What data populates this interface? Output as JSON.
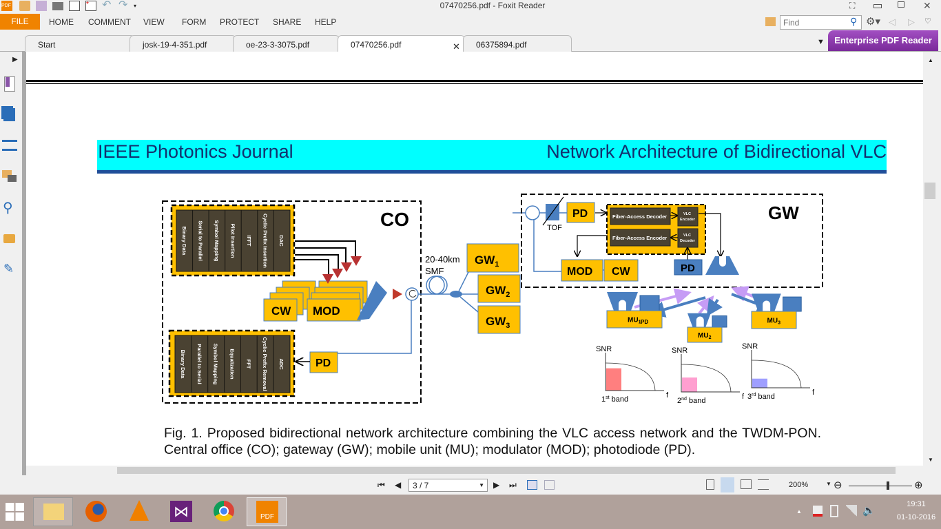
{
  "window": {
    "title": "07470256.pdf - Foxit Reader"
  },
  "menu": {
    "file": "FILE",
    "items": [
      "HOME",
      "COMMENT",
      "VIEW",
      "FORM",
      "PROTECT",
      "SHARE",
      "HELP"
    ]
  },
  "search": {
    "placeholder": "Find"
  },
  "tabs": [
    {
      "label": "Start"
    },
    {
      "label": "josk-19-4-351.pdf"
    },
    {
      "label": "oe-23-3-3075.pdf"
    },
    {
      "label": "07470256.pdf",
      "active": true
    },
    {
      "label": "06375894.pdf"
    }
  ],
  "promo": "Enterprise PDF Reader",
  "sidebar": {
    "icons": [
      "bookmark-icon",
      "pages-icon",
      "layers-icon",
      "comments-icon",
      "attachment-icon",
      "security-icon",
      "signature-icon"
    ]
  },
  "page": {
    "journal": "IEEE Photonics Journal",
    "section": "Network Architecture of Bidirectional VLC",
    "header_color": "#00ffff",
    "figure": {
      "co": "CO",
      "gw": "GW",
      "tx_blocks": [
        "Binary Data",
        "Serial to Parallel",
        "Symbol Mapping",
        "Pilot Insertion",
        "IFFT",
        "Cyclic Prefix Insertion",
        "DAC"
      ],
      "rx_blocks": [
        "Binary Data",
        "Parallel to Serial",
        "Symbol Mapping",
        "Equalization",
        "FFT",
        "Cyclic Prefix Removal",
        "ADC"
      ],
      "cw": "CW",
      "mod": "MOD",
      "pd": "PD",
      "tof": "TOF",
      "fiber1": "20-40km",
      "fiber2": "SMF",
      "gw_label": "GW",
      "gw_subs": [
        "1",
        "2",
        "3"
      ],
      "fa_decoder": "Fiber-Access Decoder",
      "fa_encoder": "Fiber-Access Encoder",
      "vlc_enc": [
        "VLC",
        "Encoder"
      ],
      "vlc_dec": [
        "VLC",
        "Decoder"
      ],
      "mu_label": "MU",
      "mu_subs": [
        "1",
        "2",
        "3"
      ],
      "snr": "SNR",
      "f": "f",
      "bands": [
        {
          "n": "1",
          "sup": "st",
          "label": " band",
          "color": "#ff7f7f"
        },
        {
          "n": "2",
          "sup": "nd",
          "label": " band",
          "color": "#ff9fd0"
        },
        {
          "n": "3",
          "sup": "rd",
          "label": " band",
          "color": "#9f9fff"
        }
      ]
    },
    "caption": "Fig. 1. Proposed bidirectional network architecture combining the VLC access network and the TWDM-PON. Central office (CO); gateway (GW); mobile unit (MU); modulator (MOD); photodiode (PD)."
  },
  "nav": {
    "page": "3 / 7",
    "zoom": "200%",
    "zoom_slider_percent": 60
  },
  "tray": {
    "time": "19:31",
    "date": "01-10-2016"
  },
  "taskbar": [
    "start-icon",
    "file-explorer-icon",
    "firefox-icon",
    "vlc-icon",
    "visual-studio-icon",
    "chrome-icon",
    "foxit-icon"
  ]
}
